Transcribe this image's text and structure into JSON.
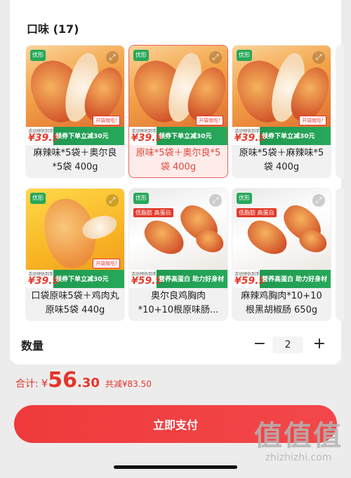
{
  "section": {
    "title": "口味 (17)"
  },
  "products": [
    {
      "name": "麻辣味*5袋＋奥尔良*5袋 400g",
      "selected": false,
      "image": "fried-chicken-strips",
      "brand": "优形",
      "price_label": "活动预估到手",
      "price": "¥39.9",
      "promo": "领券下单立减30元",
      "badge": "开袋就吃!"
    },
    {
      "name": "原味*5袋＋奥尔良*5袋 400g",
      "selected": true,
      "image": "fried-chicken-strips",
      "brand": "优形",
      "price_label": "活动预估到手",
      "price": "¥39.9",
      "promo": "领券下单立减30元",
      "badge": "开袋就吃!"
    },
    {
      "name": "原味*5袋＋麻辣味*5袋 400g",
      "selected": false,
      "image": "fried-chicken-strips",
      "brand": "优形",
      "price_label": "活动预估到手",
      "price": "¥39.9",
      "promo": "领券下单立减30元",
      "badge": "开袋就吃!"
    },
    {
      "name": "口袋原味5袋＋鸡肉丸原味5袋 440g",
      "selected": false,
      "image": "chicken-breast-yellow",
      "brand": "优形",
      "price_label": "活动预估到手",
      "price": "¥39.9",
      "promo": "领券下单立减30元",
      "badge": "开袋就吃!"
    },
    {
      "name": "奥尔良鸡胸肉*10+10根原味肠...",
      "selected": false,
      "image": "chicken-breast-plate",
      "brand": "优形",
      "tag": "低脂肪 高蛋白",
      "price_label": "活动预估到手",
      "price": "¥59.9",
      "promo": "营养高蛋白 助力好身材"
    },
    {
      "name": "麻辣鸡胸肉*10+10根黑胡椒肠 650g",
      "selected": false,
      "image": "chicken-breast-plate",
      "brand": "优形",
      "tag": "低脂肪 高蛋白",
      "price_label": "活动预估到手",
      "price": "¥59.9",
      "promo": "营养高蛋白 助力好身材"
    }
  ],
  "quantity": {
    "label": "数量",
    "minus": "−",
    "plus": "+",
    "value": "2"
  },
  "total": {
    "label": "合计:",
    "currency": "¥",
    "integer": "56",
    "decimal": ".30",
    "savings": "共减¥83.50"
  },
  "pay_button": {
    "label": "立即支付"
  },
  "watermark": {
    "glyphs": "值值值",
    "site": "zhizhizhi.com"
  },
  "colors": {
    "accent": "#e5352b",
    "promo_green": "#27a85a",
    "selected_bg": "#fdecea"
  }
}
